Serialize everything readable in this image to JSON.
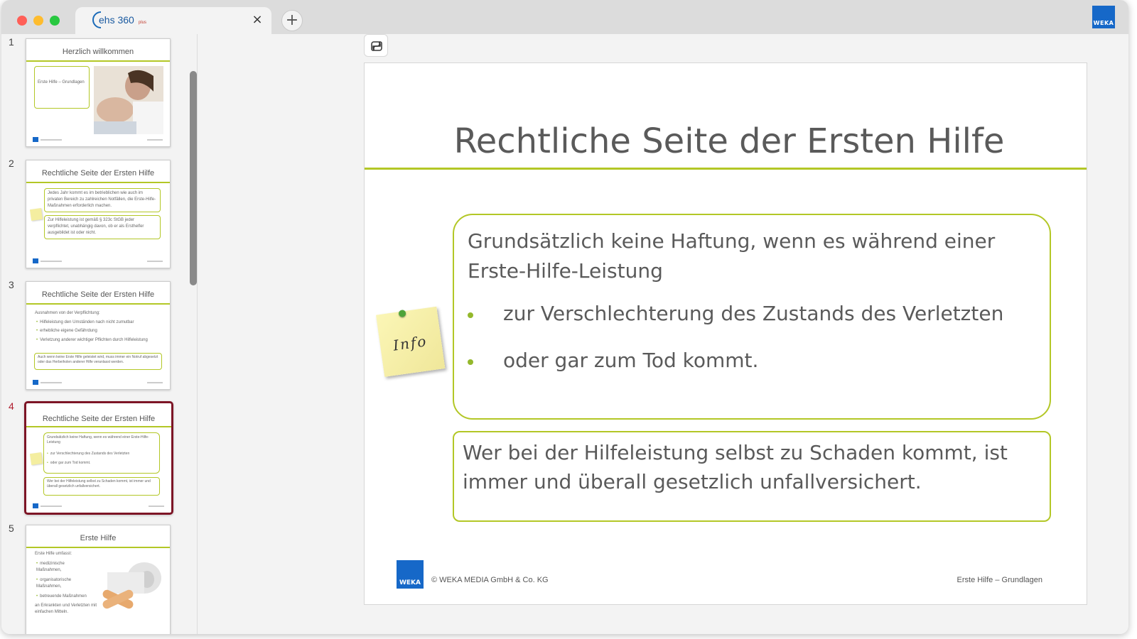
{
  "browser": {
    "tab_title": "ehs 360",
    "tab_title_suffix": "plus",
    "close_label": "×",
    "new_tab_label": "+",
    "brand_label": "WEKA"
  },
  "thumbnails": [
    {
      "number": "1",
      "title": "Herzlich willkommen",
      "box_text": "Erste Hilfe – Grundlagen"
    },
    {
      "number": "2",
      "title": "Rechtliche Seite der Ersten Hilfe",
      "box1": "Jedes Jahr kommt es im betrieblichen wie auch im privaten Bereich zu zahlreichen Notfällen, die Erste-Hilfe-Maßnahmen erforderlich machen.",
      "box2": "Zur Hilfeleistung ist gemäß § 323c StGB jeder verpflichtet, unabhängig davon, ob er als Ersthelfer ausgebildet ist oder nicht."
    },
    {
      "number": "3",
      "title": "Rechtliche Seite der Ersten Hilfe",
      "intro": "Ausnahmen von der Verpflichtung:",
      "bullets": [
        "Hilfeleistung den Umständen nach nicht zumutbar",
        "erhebliche eigene Gefährdung",
        "Verletzung anderer wichtiger Pflichten durch Hilfeleistung"
      ],
      "box": "Auch wenn keine Erste Hilfe geleistet wird, muss immer ein Notruf abgesetzt oder das Herbeiholen anderer Hilfe veranlasst werden."
    },
    {
      "number": "4",
      "title": "Rechtliche Seite der Ersten Hilfe",
      "box1": "Grundsätzlich keine Haftung, wenn es während einer Erste-Hilfe-Leistung",
      "bullets": [
        "zur Verschlechterung des Zustands des Verletzten",
        "oder gar zum Tod kommt."
      ],
      "box2": "Wer bei der Hilfeleistung selbst zu Schaden kommt, ist immer und überall gesetzlich unfallversichert."
    },
    {
      "number": "5",
      "title": "Erste Hilfe",
      "intro": "Erste Hilfe umfasst:",
      "bullets": [
        "medizinische Maßnahmen,",
        "organisatorische Maßnahmen,",
        "betreuende Maßnahmen"
      ],
      "outro": "an Erkrankten und Verletzten mit einfachen Mitteln."
    }
  ],
  "slide": {
    "title": "Rechtliche Seite der Ersten Hilfe",
    "box1_text": "Grundsätzlich keine Haftung, wenn es während einer Erste-Hilfe-Leistung",
    "bullets": [
      "zur Verschlechterung des Zustands des Verletzten",
      "oder gar zum Tod kommt."
    ],
    "box2_text": "Wer bei der Hilfeleistung selbst zu Schaden kommt, ist immer und überall gesetzlich unfallversichert.",
    "note_label": "Info",
    "logo_label": "WEKA",
    "copyright": "© WEKA MEDIA GmbH & Co. KG",
    "footer_right": "Erste Hilfe – Grundlagen"
  },
  "colors": {
    "accent_green": "#b3c726",
    "bullet_green": "#94b82c",
    "active_border": "#7d1526",
    "weka_blue": "#1668c8"
  }
}
